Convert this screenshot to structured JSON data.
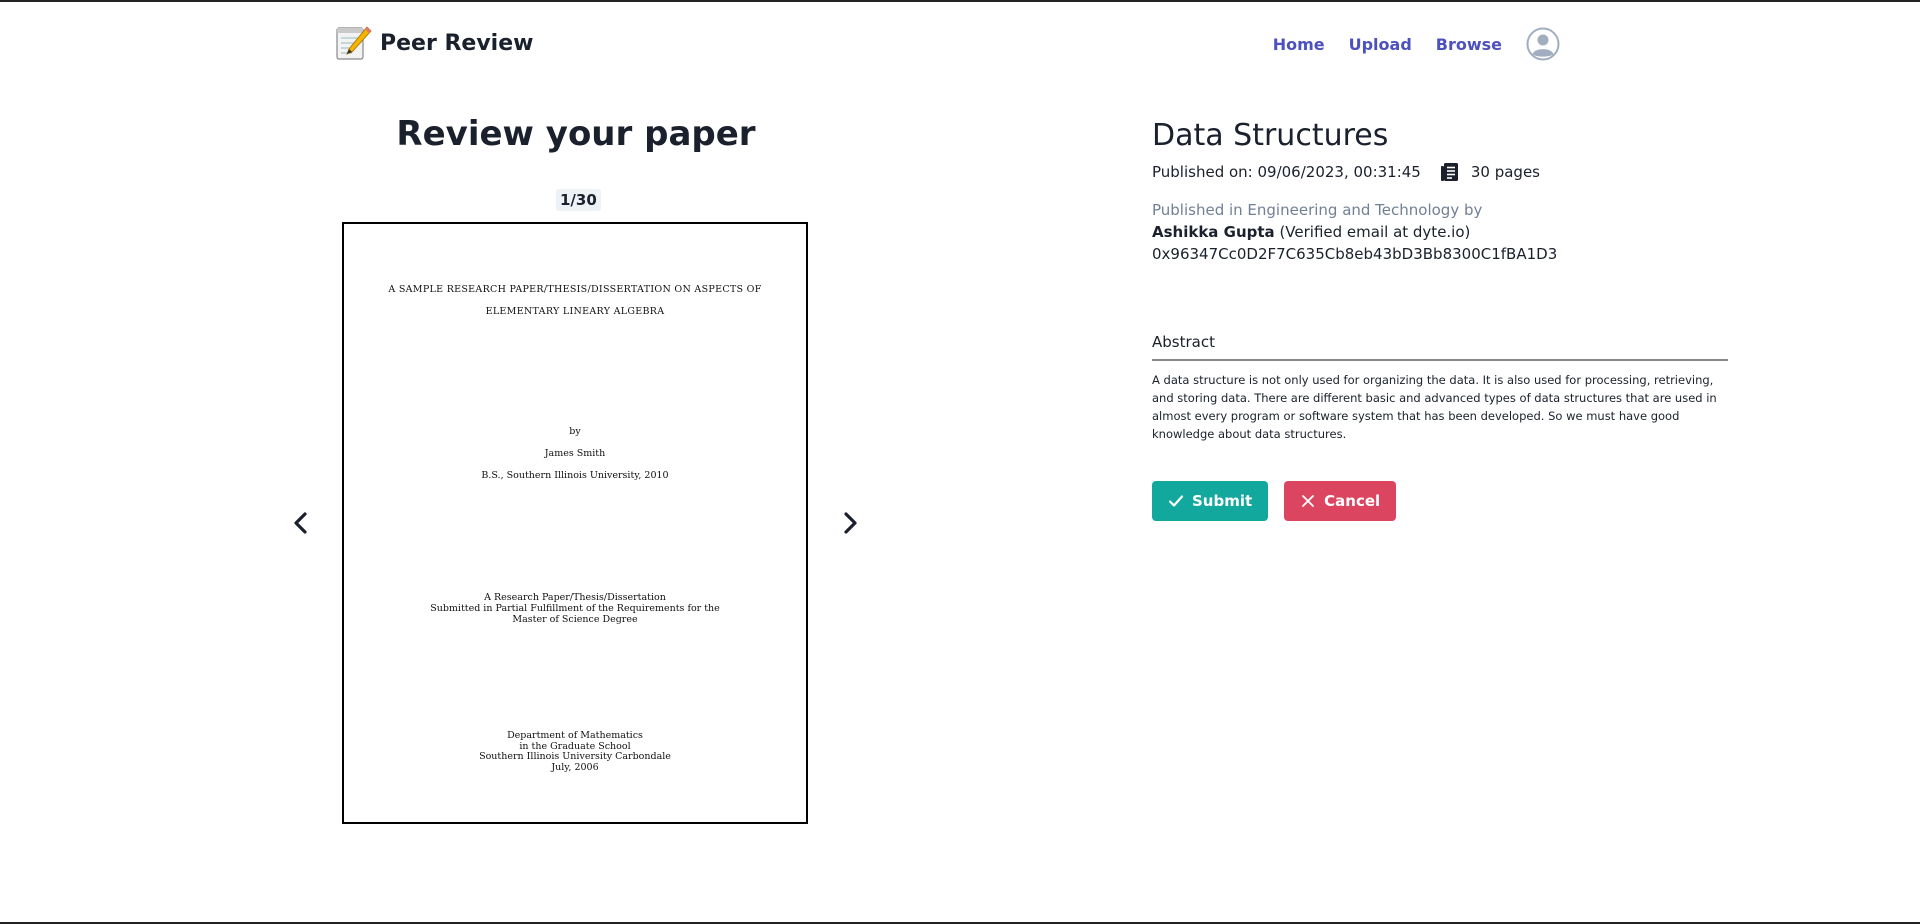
{
  "header": {
    "brand": "Peer Review",
    "logo_icon": "memo-pencil-icon",
    "nav": {
      "home": "Home",
      "upload": "Upload",
      "browse": "Browse"
    },
    "avatar_icon": "user-avatar-icon"
  },
  "viewer": {
    "title": "Review your paper",
    "page_indicator": "1/30",
    "prev_icon": "chevron-left-icon",
    "next_icon": "chevron-right-icon",
    "page": {
      "title_line1": "A SAMPLE RESEARCH PAPER/THESIS/DISSERTATION ON ASPECTS OF",
      "title_line2": "ELEMENTARY LINEARY ALGEBRA",
      "by": "by",
      "author": "James Smith",
      "degree": "B.S., Southern Illinois University, 2010",
      "submission": [
        "A Research Paper/Thesis/Dissertation",
        "Submitted in Partial Fulfillment of the Requirements for the",
        "Master of Science Degree"
      ],
      "department": [
        "Department of Mathematics",
        "in the Graduate School",
        "Southern Illinois University Carbondale",
        "July, 2006"
      ]
    }
  },
  "details": {
    "title": "Data Structures",
    "published_on": "Published on: 09/06/2023, 00:31:45",
    "pages_icon": "document-pages-icon",
    "pages": "30 pages",
    "category": "Published in Engineering and Technology by",
    "author_name": "Ashikka Gupta",
    "author_verified": " (Verified email at dyte.io)",
    "address": "0x96347Cc0D2F7C635Cb8eb43bD3Bb8300C1fBA1D3",
    "abstract_heading": "Abstract",
    "abstract_text": "A data structure is not only used for organizing the data. It is also used for processing, retrieving, and storing data. There are different basic and advanced types of data structures that are used in almost every program or software system that has been developed. So we must have good knowledge about data structures."
  },
  "actions": {
    "submit": "Submit",
    "submit_icon": "check-icon",
    "cancel": "Cancel",
    "cancel_icon": "close-icon"
  },
  "colors": {
    "nav_link": "#4c51bf",
    "submit_bg": "#13a89e",
    "cancel_bg": "#dc4560",
    "muted_text": "#718096"
  }
}
